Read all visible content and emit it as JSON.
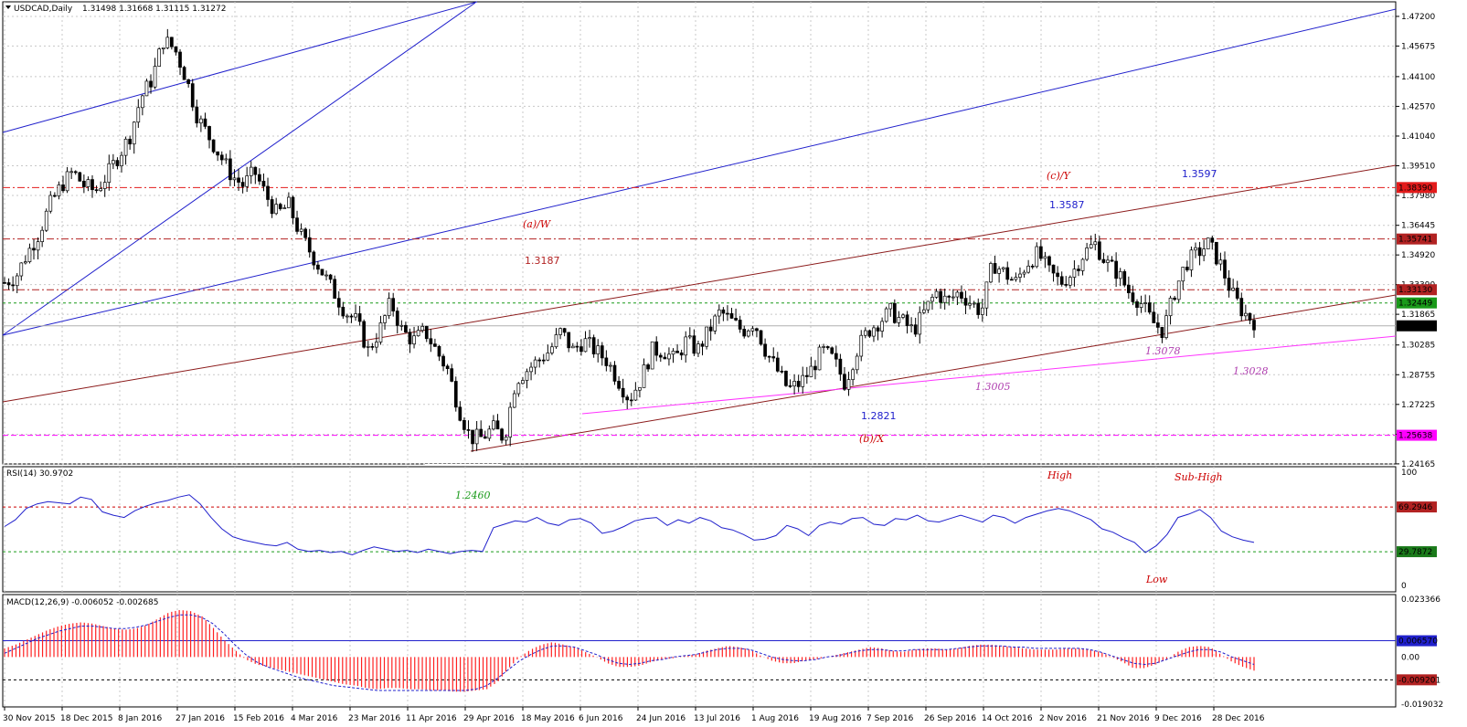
{
  "symbol": "USDCAD,Daily",
  "ohlc_header": "1.31498 1.31668 1.31115 1.31272",
  "rsi_header": "RSI(14) 30.9702",
  "macd_header": "MACD(12,26,9) -0.006052 -0.002685",
  "chart_data": [
    {
      "type": "candlestick",
      "panel": "price",
      "ylim": [
        1.2416,
        1.4795
      ],
      "y_ticks": [
        "1.47200",
        "1.45675",
        "1.44100",
        "1.42570",
        "1.41040",
        "1.39510",
        "1.37980",
        "1.36445",
        "1.34920",
        "1.33390",
        "1.31865",
        "1.30285",
        "1.28755",
        "1.27225",
        "1.25690",
        "1.24165"
      ],
      "x_ticks": [
        "30 Nov 2015",
        "18 Dec 2015",
        "8 Jan 2016",
        "27 Jan 2016",
        "15 Feb 2016",
        "4 Mar 2016",
        "23 Mar 2016",
        "11 Apr 2016",
        "29 Apr 2016",
        "18 May 2016",
        "6 Jun 2016",
        "24 Jun 2016",
        "13 Jul 2016",
        "1 Aug 2016",
        "19 Aug 2016",
        "7 Sep 2016",
        "26 Sep 2016",
        "14 Oct 2016",
        "2 Nov 2016",
        "21 Nov 2016",
        "9 Dec 2016",
        "28 Dec 2016"
      ],
      "close_path": [
        1.335,
        1.338,
        1.35,
        1.36,
        1.375,
        1.385,
        1.392,
        1.385,
        1.382,
        1.39,
        1.4,
        1.41,
        1.43,
        1.44,
        1.46,
        1.455,
        1.44,
        1.42,
        1.41,
        1.4,
        1.39,
        1.385,
        1.392,
        1.38,
        1.37,
        1.375,
        1.36,
        1.35,
        1.34,
        1.33,
        1.32,
        1.315,
        1.3,
        1.31,
        1.325,
        1.31,
        1.305,
        1.31,
        1.3,
        1.29,
        1.27,
        1.255,
        1.255,
        1.26,
        1.255,
        1.285,
        1.29,
        1.295,
        1.3,
        1.31,
        1.3,
        1.305,
        1.3,
        1.295,
        1.285,
        1.275,
        1.285,
        1.3,
        1.3,
        1.295,
        1.305,
        1.3,
        1.31,
        1.32,
        1.315,
        1.31,
        1.315,
        1.3,
        1.29,
        1.28,
        1.283,
        1.29,
        1.3,
        1.295,
        1.283,
        1.3,
        1.31,
        1.315,
        1.32,
        1.315,
        1.31,
        1.32,
        1.33,
        1.325,
        1.33,
        1.325,
        1.32,
        1.345,
        1.34,
        1.335,
        1.345,
        1.35,
        1.34,
        1.335,
        1.34,
        1.35,
        1.355,
        1.345,
        1.34,
        1.33,
        1.325,
        1.315,
        1.31,
        1.33,
        1.345,
        1.35,
        1.355,
        1.345,
        1.33,
        1.32,
        1.315
      ],
      "current_price": "1.31272",
      "price_labels": [
        {
          "value": 1.3839,
          "text": "1.38390",
          "color": "#e31b1b"
        },
        {
          "value": 1.35741,
          "text": "1.35741",
          "color": "#b22222"
        },
        {
          "value": 1.3313,
          "text": "1.33130",
          "color": "#b22222"
        },
        {
          "value": 1.32449,
          "text": "1.32449",
          "color": "#1a9a1a"
        },
        {
          "value": 1.31272,
          "text": "1.31272",
          "color": "#000000"
        },
        {
          "value": 1.25638,
          "text": "1.25638",
          "color": "#ff00ff"
        }
      ],
      "annotations": [
        "(a)/W",
        "1.3187",
        "(c)/Y",
        "1.3587",
        "1.3597",
        "1.2821",
        "(b)/X",
        "1.2460",
        "1.3078",
        "1.3005",
        "1.3028"
      ]
    },
    {
      "type": "line",
      "panel": "rsi",
      "ylim": [
        0,
        100
      ],
      "y_ticks": [
        "100",
        "0"
      ],
      "levels": [
        {
          "value": 69.2946,
          "text": "69.2946"
        },
        {
          "value": 29.7872,
          "text": "29.7872"
        }
      ],
      "values": [
        52,
        58,
        68,
        72,
        74,
        73,
        72,
        78,
        76,
        65,
        62,
        60,
        66,
        70,
        73,
        75,
        78,
        80,
        72,
        60,
        50,
        43,
        40,
        38,
        36,
        35,
        38,
        32,
        30,
        31,
        29,
        30,
        27,
        31,
        34,
        32,
        30,
        31,
        29,
        32,
        30,
        28,
        30,
        31,
        30,
        51,
        54,
        57,
        56,
        60,
        55,
        53,
        58,
        59,
        55,
        46,
        48,
        52,
        57,
        59,
        60,
        53,
        58,
        55,
        60,
        57,
        51,
        49,
        45,
        40,
        41,
        44,
        53,
        50,
        44,
        53,
        56,
        54,
        59,
        60,
        54,
        53,
        59,
        58,
        62,
        57,
        56,
        59,
        62,
        59,
        56,
        62,
        60,
        55,
        60,
        63,
        66,
        68,
        66,
        62,
        58,
        50,
        47,
        42,
        38,
        29,
        35,
        45,
        60,
        63,
        67,
        60,
        48,
        43,
        40,
        38
      ],
      "labels": [
        "High",
        "Sub-High",
        "Low"
      ]
    },
    {
      "type": "histogram",
      "panel": "macd",
      "ylim": [
        -0.019032,
        0.023366
      ],
      "y_ticks": [
        "0.023366",
        "0.00",
        "-0.019032"
      ],
      "level_labels": [
        {
          "value": 0.00657,
          "text": "0.006570"
        },
        {
          "value": -0.0092,
          "text": "-0.009201"
        }
      ],
      "histogram": [
        0.0035,
        0.005,
        0.007,
        0.009,
        0.011,
        0.0125,
        0.0135,
        0.014,
        0.0135,
        0.0125,
        0.0115,
        0.011,
        0.0115,
        0.013,
        0.0155,
        0.018,
        0.019,
        0.0185,
        0.0165,
        0.012,
        0.007,
        0.003,
        -0.001,
        -0.003,
        -0.004,
        -0.005,
        -0.006,
        -0.007,
        -0.008,
        -0.009,
        -0.01,
        -0.011,
        -0.0115,
        -0.0125,
        -0.013,
        -0.0125,
        -0.0125,
        -0.013,
        -0.013,
        -0.0135,
        -0.0135,
        -0.014,
        -0.014,
        -0.0135,
        -0.013,
        -0.01,
        -0.0045,
        0.0,
        0.003,
        0.005,
        0.006,
        0.005,
        0.004,
        0.002,
        0.0,
        -0.0025,
        -0.004,
        -0.004,
        -0.0035,
        -0.002,
        -0.001,
        -0.0005,
        0.0005,
        0.001,
        0.0025,
        0.0035,
        0.0045,
        0.004,
        0.003,
        0.0005,
        -0.0015,
        -0.0025,
        -0.0025,
        -0.0015,
        -0.001,
        0.0,
        0.001,
        0.002,
        0.003,
        0.004,
        0.0035,
        0.0025,
        0.002,
        0.003,
        0.0035,
        0.0035,
        0.003,
        0.0035,
        0.0045,
        0.005,
        0.005,
        0.0045,
        0.004,
        0.0035,
        0.003,
        0.003,
        0.003,
        0.0035,
        0.0035,
        0.003,
        0.002,
        0.0,
        -0.002,
        -0.0045,
        -0.0045,
        -0.003,
        -0.001,
        0.002,
        0.004,
        0.0045,
        0.004,
        0.001,
        -0.002,
        -0.004,
        -0.0055
      ],
      "signal": [
        0.0015,
        0.0035,
        0.0055,
        0.0075,
        0.009,
        0.0105,
        0.0115,
        0.0125,
        0.0125,
        0.012,
        0.0115,
        0.0115,
        0.012,
        0.013,
        0.0145,
        0.016,
        0.017,
        0.017,
        0.016,
        0.0135,
        0.0095,
        0.005,
        0.001,
        -0.002,
        -0.004,
        -0.0055,
        -0.007,
        -0.0085,
        -0.0095,
        -0.0105,
        -0.0115,
        -0.012,
        -0.0125,
        -0.013,
        -0.0135,
        -0.0135,
        -0.0135,
        -0.0135,
        -0.0135,
        -0.0135,
        -0.0135,
        -0.0135,
        -0.0135,
        -0.013,
        -0.0115,
        -0.0085,
        -0.005,
        -0.0015,
        0.001,
        0.003,
        0.0045,
        0.0045,
        0.004,
        0.0025,
        0.001,
        -0.001,
        -0.0025,
        -0.003,
        -0.0025,
        -0.0015,
        -0.001,
        0.0,
        0.0005,
        0.001,
        0.002,
        0.003,
        0.0035,
        0.0035,
        0.003,
        0.0015,
        0.0,
        -0.001,
        -0.0015,
        -0.0015,
        -0.001,
        0.0,
        0.0005,
        0.0015,
        0.0025,
        0.003,
        0.003,
        0.0025,
        0.0025,
        0.003,
        0.003,
        0.003,
        0.003,
        0.0035,
        0.004,
        0.0045,
        0.0045,
        0.0045,
        0.004,
        0.004,
        0.0035,
        0.0035,
        0.0035,
        0.0035,
        0.0035,
        0.003,
        0.002,
        0.0005,
        -0.001,
        -0.0025,
        -0.003,
        -0.0025,
        -0.001,
        0.0005,
        0.002,
        0.003,
        0.003,
        0.002,
        0.0,
        -0.0015,
        -0.003
      ]
    }
  ]
}
